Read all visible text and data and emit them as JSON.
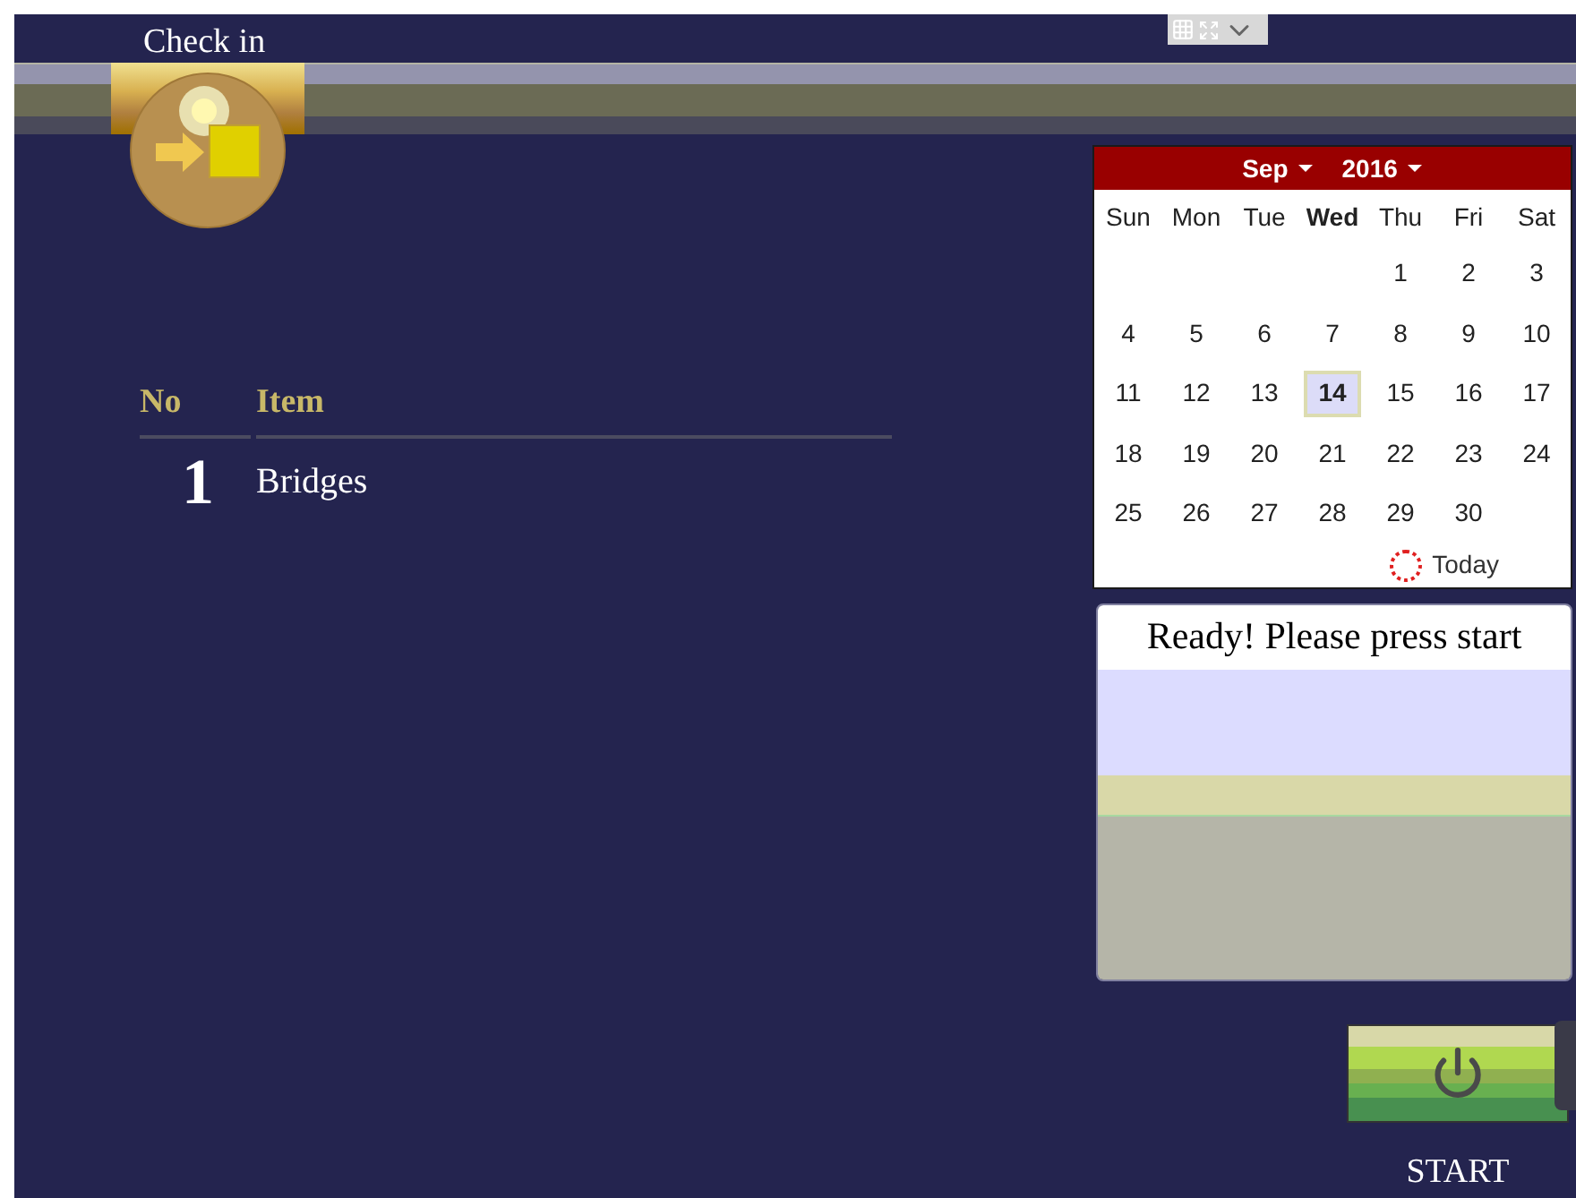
{
  "header": {
    "title": "Check in"
  },
  "table": {
    "columns": [
      "No",
      "Item"
    ],
    "rows": [
      {
        "no": "1",
        "item": "Bridges"
      }
    ]
  },
  "calendar": {
    "month": "Sep",
    "year": "2016",
    "weekdays": [
      {
        "label": "Sun",
        "selected": false
      },
      {
        "label": "Mon",
        "selected": false
      },
      {
        "label": "Tue",
        "selected": false
      },
      {
        "label": "Wed",
        "selected": true
      },
      {
        "label": "Thu",
        "selected": false
      },
      {
        "label": "Fri",
        "selected": false
      },
      {
        "label": "Sat",
        "selected": false
      }
    ],
    "weeks": [
      [
        {
          "kind": "blank"
        },
        {
          "kind": "blank"
        },
        {
          "kind": "blank"
        },
        {
          "kind": "blank"
        },
        {
          "kind": "day",
          "label": "1",
          "selected": false
        },
        {
          "kind": "day",
          "label": "2",
          "selected": false
        },
        {
          "kind": "day",
          "label": "3",
          "selected": false
        }
      ],
      [
        {
          "kind": "day",
          "label": "4",
          "selected": false
        },
        {
          "kind": "day",
          "label": "5",
          "selected": false
        },
        {
          "kind": "day",
          "label": "6",
          "selected": false
        },
        {
          "kind": "day",
          "label": "7",
          "selected": false
        },
        {
          "kind": "day",
          "label": "8",
          "selected": false
        },
        {
          "kind": "day",
          "label": "9",
          "selected": false
        },
        {
          "kind": "day",
          "label": "10",
          "selected": false
        }
      ],
      [
        {
          "kind": "day",
          "label": "11",
          "selected": false
        },
        {
          "kind": "day",
          "label": "12",
          "selected": false
        },
        {
          "kind": "day",
          "label": "13",
          "selected": false
        },
        {
          "kind": "day",
          "label": "14",
          "selected": true
        },
        {
          "kind": "day",
          "label": "15",
          "selected": false
        },
        {
          "kind": "day",
          "label": "16",
          "selected": false
        },
        {
          "kind": "day",
          "label": "17",
          "selected": false
        }
      ],
      [
        {
          "kind": "day",
          "label": "18",
          "selected": false
        },
        {
          "kind": "day",
          "label": "19",
          "selected": false
        },
        {
          "kind": "day",
          "label": "20",
          "selected": false
        },
        {
          "kind": "day",
          "label": "21",
          "selected": false
        },
        {
          "kind": "day",
          "label": "22",
          "selected": false
        },
        {
          "kind": "day",
          "label": "23",
          "selected": false
        },
        {
          "kind": "day",
          "label": "24",
          "selected": false
        }
      ],
      [
        {
          "kind": "day",
          "label": "25",
          "selected": false
        },
        {
          "kind": "day",
          "label": "26",
          "selected": false
        },
        {
          "kind": "day",
          "label": "27",
          "selected": false
        },
        {
          "kind": "day",
          "label": "28",
          "selected": false
        },
        {
          "kind": "day",
          "label": "29",
          "selected": false
        },
        {
          "kind": "day",
          "label": "30",
          "selected": false
        }
      ]
    ],
    "today": "Today"
  },
  "status": {
    "message": "Ready! Please press start"
  },
  "start_button": {
    "label": "START"
  }
}
